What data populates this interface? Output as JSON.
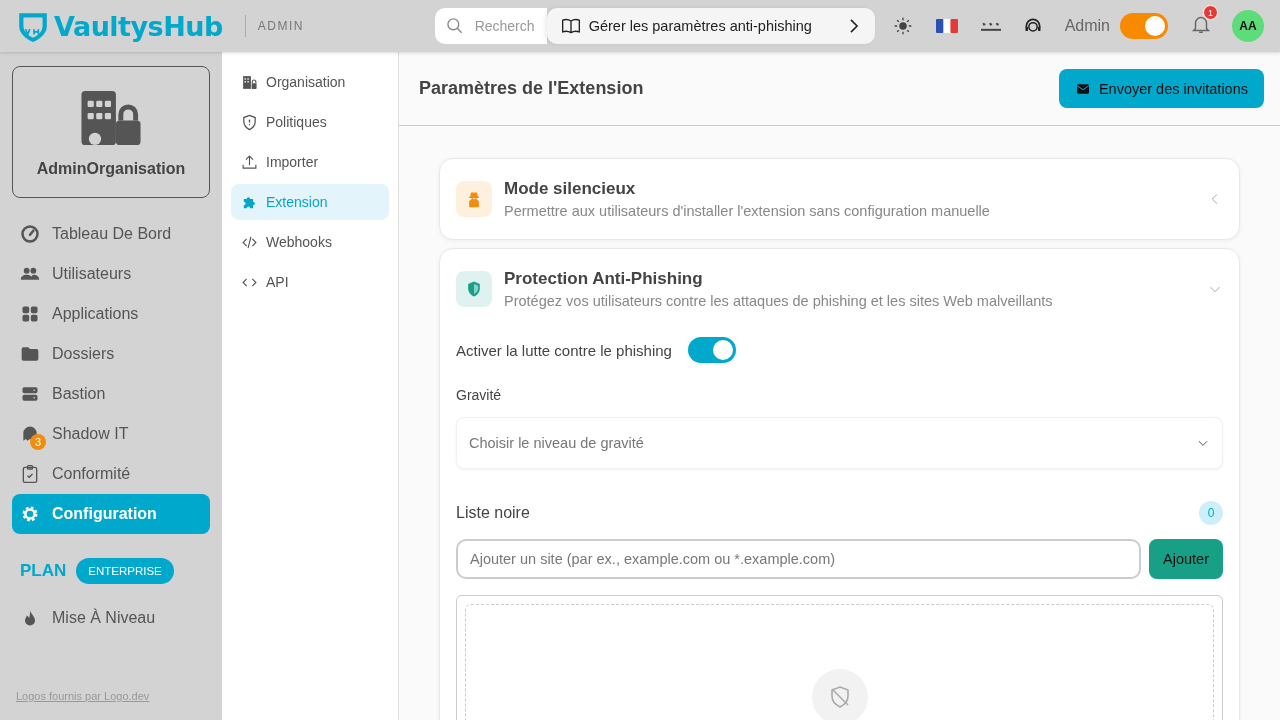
{
  "header": {
    "logo": "VaultysHub",
    "section": "ADMIN",
    "search": {
      "placeholder": "Recherch"
    },
    "tooltip": "Gérer les paramètres anti-phishing",
    "user_label": "Admin",
    "admin_mode": {
      "on": true
    },
    "notifications": {
      "count": "1"
    },
    "avatar": "AA"
  },
  "sidebar": {
    "organisation": "AdminOrganisation",
    "items": [
      {
        "label": "Tableau De Bord",
        "selected": false
      },
      {
        "label": "Utilisateurs",
        "selected": false
      },
      {
        "label": "Applications",
        "selected": false
      },
      {
        "label": "Dossiers",
        "selected": false
      },
      {
        "label": "Bastion",
        "selected": false
      },
      {
        "label": "Shadow IT",
        "selected": false,
        "badge": "3"
      },
      {
        "label": "Conformité",
        "selected": false
      },
      {
        "label": "Configuration",
        "selected": true
      }
    ],
    "plan": {
      "label": "PLAN",
      "tier": "ENTERPRISE"
    },
    "upgrade": "Mise À Niveau",
    "footer_link": "Logos fournis par Logo.dev"
  },
  "subnav": {
    "items": [
      {
        "label": "Organisation",
        "selected": false
      },
      {
        "label": "Politiques",
        "selected": false
      },
      {
        "label": "Importer",
        "selected": false
      },
      {
        "label": "Extension",
        "selected": true
      },
      {
        "label": "Webhooks",
        "selected": false
      },
      {
        "label": "API",
        "selected": false
      }
    ]
  },
  "main": {
    "title": "Paramètres de l'Extension",
    "invite_button": "Envoyer des invitations",
    "sections": [
      {
        "title": "Mode silencieux",
        "description": "Permettre aux utilisateurs d'installer l'extension sans configuration manuelle",
        "expanded": false,
        "color": "#f28c0f"
      },
      {
        "title": "Protection Anti-Phishing",
        "description": "Protégez vos utilisateurs contre les attaques de phishing et les sites Web malveillants",
        "expanded": true,
        "color": "#17a085",
        "content": {
          "enable_label": "Activer la lutte contre le phishing",
          "enabled": true,
          "severity_label": "Gravité",
          "severity_placeholder": "Choisir le niveau de gravité",
          "blacklist": {
            "title": "Liste noire",
            "count": "0",
            "input_placeholder": "Ajouter un site (par ex., example.com ou *.example.com)",
            "add_button": "Ajouter"
          }
        }
      }
    ]
  }
}
